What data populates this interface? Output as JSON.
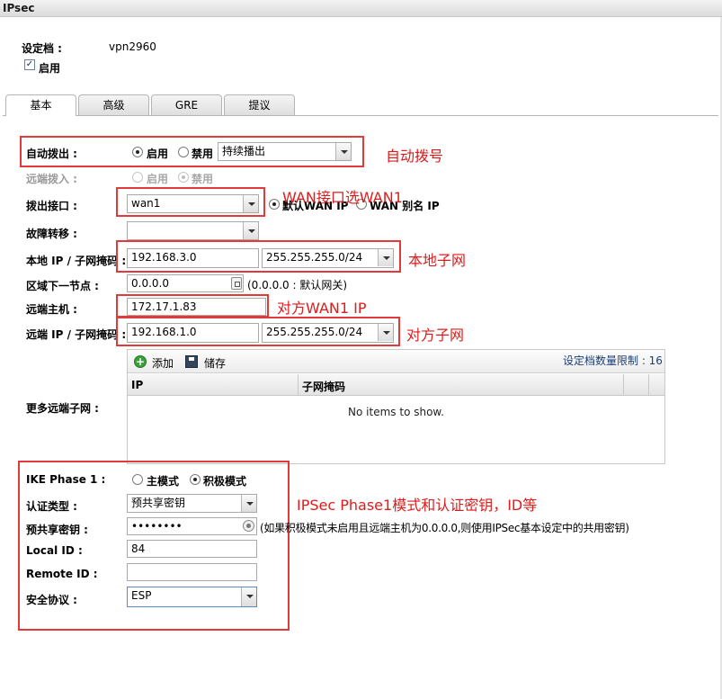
{
  "window": {
    "title": "IPsec"
  },
  "profile": {
    "label": "设定档 :",
    "value": "vpn2960",
    "enable_label": "启用",
    "enabled": true
  },
  "tabs": [
    {
      "label": "基本",
      "active": true
    },
    {
      "label": "高级",
      "active": false
    },
    {
      "label": "GRE",
      "active": false
    },
    {
      "label": "提议",
      "active": false
    }
  ],
  "form": {
    "auto_dialout": {
      "label": "自动拨出 :",
      "enable_label": "启用",
      "disable_label": "禁用",
      "selected": "enable",
      "mode_value": "持续播出"
    },
    "remote_dialin": {
      "label": "远端拨入 :",
      "enable_label": "启用",
      "disable_label": "禁用",
      "selected": "disable"
    },
    "dialout_interface": {
      "label": "拨出接口 :",
      "value": "wan1",
      "opt_default": "默认WAN IP",
      "opt_alias": "WAN 别名 IP",
      "selected": "default"
    },
    "failover": {
      "label": "故障转移 :",
      "value": ""
    },
    "local_ip": {
      "label": "本地 IP / 子网掩码 :",
      "ip": "192.168.3.0",
      "mask": "255.255.255.0/24"
    },
    "next_hop": {
      "label": "区域下一节点 :",
      "value": "0.0.0.0",
      "hint": "(0.0.0.0 : 默认网关)"
    },
    "remote_host": {
      "label": "远端主机 :",
      "value": "172.17.1.83"
    },
    "remote_ip": {
      "label": "远端 IP / 子网掩码 :",
      "ip": "192.168.1.0",
      "mask": "255.255.255.0/24"
    },
    "more_subnets": {
      "label": "更多远端子网 :",
      "add_label": "添加",
      "save_label": "储存",
      "limit_text": "设定档数量限制 : 16",
      "columns": [
        "IP",
        "子网掩码"
      ],
      "empty_text": "No items to show."
    },
    "ike_phase1": {
      "label": "IKE Phase 1 :",
      "main_label": "主模式",
      "aggressive_label": "积极模式",
      "selected": "aggressive"
    },
    "auth_type": {
      "label": "认证类型 :",
      "value": "预共享密钥"
    },
    "psk": {
      "label": "预共享密钥 :",
      "value": "••••••••",
      "hint": "(如果积极模式未启用且远端主机为0.0.0.0,则使用IPSec基本设定中的共用密钥)"
    },
    "local_id": {
      "label": "Local ID :",
      "value": "84"
    },
    "remote_id": {
      "label": "Remote ID :",
      "value": ""
    },
    "security_protocol": {
      "label": "安全协议 :",
      "value": "ESP"
    }
  },
  "annotations": {
    "auto_dial": "自动拨号",
    "wan": "WAN接口选WAN1",
    "local_subnet": "本地子网",
    "remote_wan": "对方WAN1 IP",
    "remote_subnet": "对方子网",
    "ike": "IPSec Phase1模式和认证密钥，ID等"
  },
  "colors": {
    "annotation": "#e01b1b",
    "highlight_box": "#e23a3a"
  }
}
